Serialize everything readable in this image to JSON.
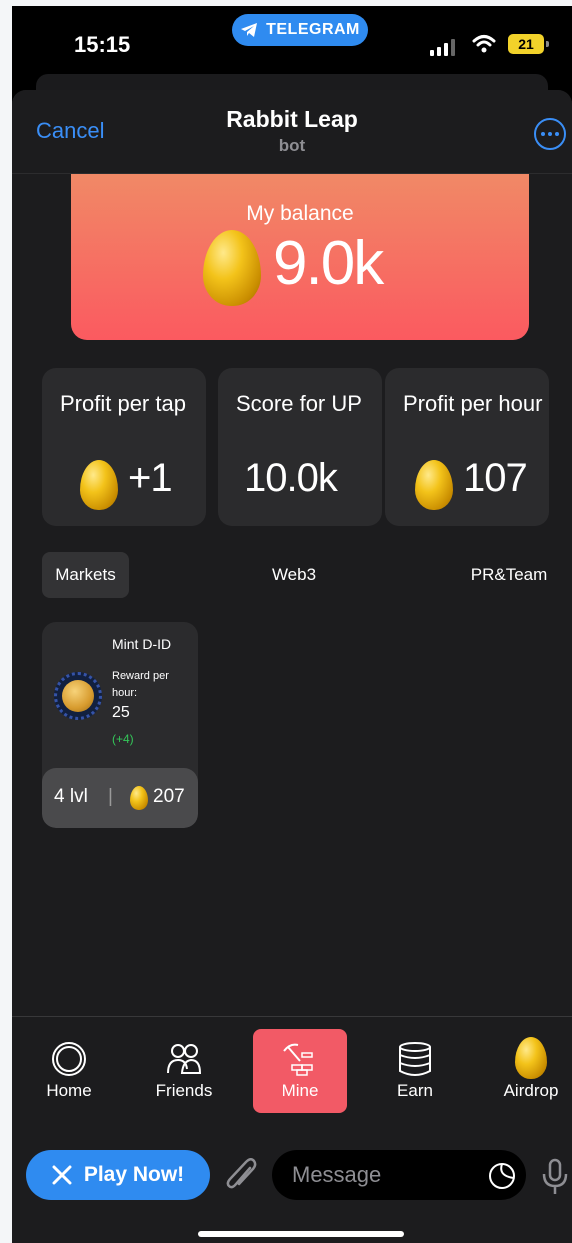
{
  "status_bar": {
    "time": "15:15",
    "pill_label": "TELEGRAM",
    "battery": "21"
  },
  "header": {
    "cancel": "Cancel",
    "title": "Rabbit Leap",
    "subtitle": "bot"
  },
  "balance": {
    "label": "My balance",
    "value": "9.0k"
  },
  "stats": [
    {
      "label": "Profit per tap",
      "value": "+1",
      "icon": "egg-icon"
    },
    {
      "label": "Score for UP",
      "value": "10.0k"
    },
    {
      "label": "Profit per hour",
      "value": "107",
      "icon": "egg-icon"
    }
  ],
  "tabs": [
    {
      "label": "Markets",
      "active": true
    },
    {
      "label": "Web3",
      "active": false
    },
    {
      "label": "PR&Team",
      "active": false
    }
  ],
  "market_cards": [
    {
      "name": "Mint D-ID",
      "reward_label": "Reward per hour:",
      "reward_value": "25",
      "reward_increase": "(+4)",
      "level": "4 lvl",
      "cost": "207"
    }
  ],
  "nav": [
    {
      "label": "Home",
      "icon": "home-ring-icon",
      "active": false
    },
    {
      "label": "Friends",
      "icon": "friends-icon",
      "active": false
    },
    {
      "label": "Mine",
      "icon": "mine-pickaxe-icon",
      "active": true
    },
    {
      "label": "Earn",
      "icon": "coin-stack-icon",
      "active": false
    },
    {
      "label": "Airdrop",
      "icon": "egg-icon",
      "active": false
    }
  ],
  "message_bar": {
    "play_label": "Play Now!",
    "placeholder": "Message"
  },
  "colors": {
    "accent_blue": "#2f8bf0",
    "balance_gradient_top": "#f08a66",
    "balance_gradient_bottom": "#fb5a60",
    "active_nav": "#f25a66",
    "increase_green": "#34c759"
  }
}
